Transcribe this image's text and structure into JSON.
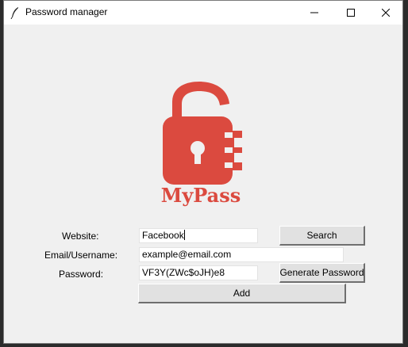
{
  "window": {
    "title": "Password manager",
    "controls": [
      "minimize-icon",
      "maximize-icon",
      "close-icon"
    ]
  },
  "logo": {
    "text": "MyPass",
    "color": "#db4a3f",
    "icon": "padlock-icon"
  },
  "form": {
    "website_label": "Website:",
    "website_value": "Facebook",
    "email_label": "Email/Username:",
    "email_value": "example@email.com",
    "password_label": "Password:",
    "password_value": "VF3Y(ZWc$oJH)e8",
    "search_button": "Search",
    "generate_button": "Generate Password",
    "add_button": "Add"
  }
}
